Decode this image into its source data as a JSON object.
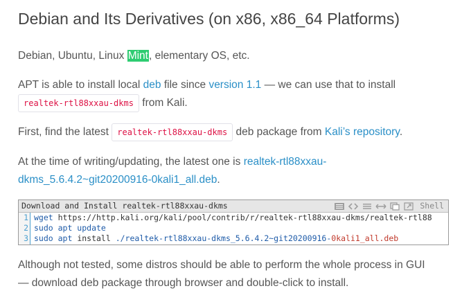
{
  "heading": "Debian and Its Derivatives (on x86, x86_64 Platforms)",
  "p1": {
    "before": "Debian, Ubuntu, Linux ",
    "highlight": "Mint",
    "after": ", elementary OS, etc."
  },
  "p2": {
    "t1": "APT is able to install local ",
    "link1": "deb",
    "t2": " file since ",
    "link2": "version 1.1",
    "t3": " — we can use that to install",
    "code": "realtek-rtl88xxau-dkms",
    "t4": " from Kali."
  },
  "p3": {
    "t1": "First, find the latest ",
    "code": "realtek-rtl88xxau-dkms",
    "t2": " deb package from ",
    "link": "Kali’s repository",
    "t3": "."
  },
  "p4": {
    "t1": "At the time of writing/updating, the latest one is ",
    "link_part1": "realtek-rtl88xxau-",
    "link_part2": "dkms_5.6.4.2~git20200916-0kali1_all.deb",
    "t2": "."
  },
  "codeblock": {
    "title": "Download and Install realtek-rtl88xxau-dkms",
    "language": "Shell",
    "toolbar_icons": [
      "menu-icon",
      "code-icon",
      "wrap-icon",
      "expand-icon",
      "copy-icon",
      "open-icon"
    ],
    "lines": [
      {
        "num": "1",
        "cmd": "wget",
        "rest": " https://http.kali.org/kali/pool/contrib/r/realtek-rtl88xxau-dkms/realtek-rtl88"
      },
      {
        "num": "2",
        "cmd": "sudo apt update",
        "rest": ""
      },
      {
        "num": "3",
        "cmd": "sudo apt",
        "arg": " install ",
        "path1": "./realtek-rtl88xxau-dkms_5.6.4.2~git20200916-",
        "red": "0kali1_all.deb"
      }
    ]
  },
  "p5": {
    "line1": "Although not tested, some distros should be able to perform the whole process in GUI",
    "line2": "— download deb package through browser and double-click to install."
  },
  "colors": {
    "link": "#2a8fc7",
    "highlight": "#2ecc71",
    "inline_code": "#dd1144",
    "code_blue": "#1e5ba8"
  }
}
